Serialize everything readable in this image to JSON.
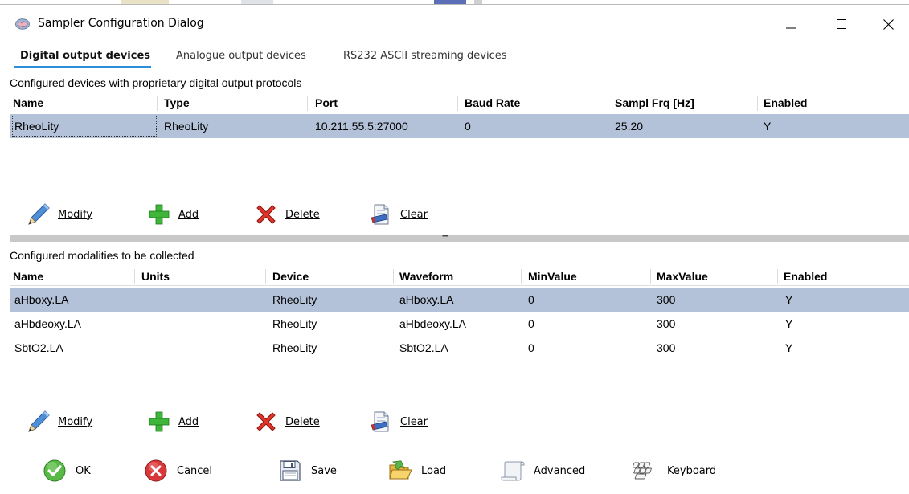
{
  "window": {
    "title": "Sampler Configuration Dialog"
  },
  "tabs": [
    {
      "label": "Digital output devices",
      "active": true
    },
    {
      "label": "Analogue output devices",
      "active": false
    },
    {
      "label": "RS232 ASCII streaming devices",
      "active": false
    }
  ],
  "devices": {
    "caption": "Configured devices with proprietary digital output protocols",
    "columns": [
      "Name",
      "Type",
      "Port",
      "Baud Rate",
      "Sampl Frq [Hz]",
      "Enabled"
    ],
    "rows": [
      {
        "name": "RheoLity",
        "type": "RheoLity",
        "port": "10.211.55.5:27000",
        "baud": "0",
        "freq": "25.20",
        "enabled": "Y",
        "selected": true
      }
    ],
    "toolbar": {
      "modify": "Modify",
      "add": "Add",
      "delete": "Delete",
      "clear": "Clear"
    }
  },
  "modalities": {
    "caption": "Configured modalities to be collected",
    "columns": [
      "Name",
      "Units",
      "Device",
      "Waveform",
      "MinValue",
      "MaxValue",
      "Enabled"
    ],
    "rows": [
      {
        "name": "aHboxy.LA",
        "units": "",
        "device": "RheoLity",
        "waveform": "aHboxy.LA",
        "min": "0",
        "max": "300",
        "enabled": "Y",
        "selected": true
      },
      {
        "name": "aHbdeoxy.LA",
        "units": "",
        "device": "RheoLity",
        "waveform": "aHbdeoxy.LA",
        "min": "0",
        "max": "300",
        "enabled": "Y",
        "selected": false
      },
      {
        "name": "SbtO2.LA",
        "units": "",
        "device": "RheoLity",
        "waveform": "SbtO2.LA",
        "min": "0",
        "max": "300",
        "enabled": "Y",
        "selected": false
      }
    ],
    "toolbar": {
      "modify": "Modify",
      "add": "Add",
      "delete": "Delete",
      "clear": "Clear"
    }
  },
  "splitter": {
    "grip": "''''''''''"
  },
  "bottom": {
    "ok": "OK",
    "cancel": "Cancel",
    "save": "Save",
    "load": "Load",
    "advanced": "Advanced",
    "keyboard": "Keyboard"
  },
  "colors": {
    "selection": "#b3c2d9",
    "tab_accent": "#2a8fd6",
    "splitter": "#c8c8c8"
  }
}
